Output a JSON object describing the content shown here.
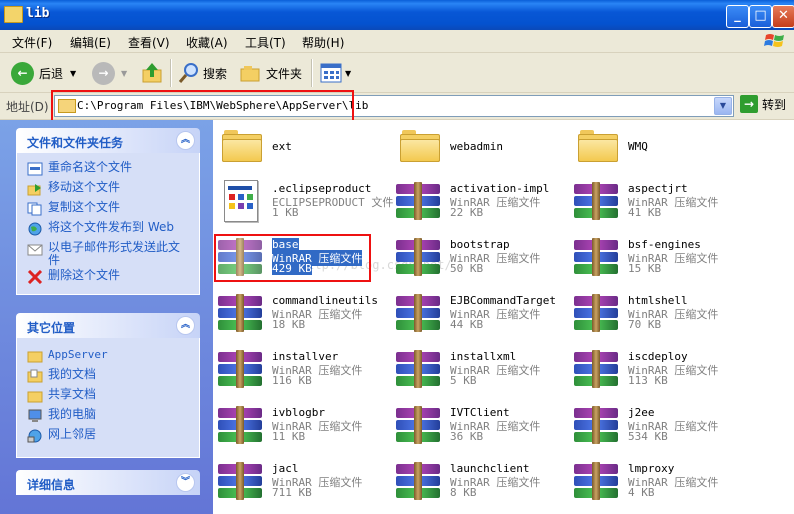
{
  "window": {
    "title": "lib"
  },
  "menu": [
    "文件(F)",
    "编辑(E)",
    "查看(V)",
    "收藏(A)",
    "工具(T)",
    "帮助(H)"
  ],
  "toolbar": {
    "back": "后退",
    "search": "搜索",
    "folders": "文件夹"
  },
  "address": {
    "label": "地址(D)",
    "path": "C:\\Program Files\\IBM\\WebSphere\\AppServer\\lib",
    "go": "转到"
  },
  "tasks": {
    "title": "文件和文件夹任务",
    "items": [
      "重命名这个文件",
      "移动这个文件",
      "复制这个文件",
      "将这个文件发布到 Web",
      "以电子邮件形式发送此文件",
      "删除这个文件"
    ]
  },
  "places": {
    "title": "其它位置",
    "items": [
      "AppServer",
      "我的文档",
      "共享文档",
      "我的电脑",
      "网上邻居"
    ]
  },
  "details": {
    "title": "详细信息"
  },
  "files": [
    {
      "name": "ext",
      "kind": "folder"
    },
    {
      "name": "webadmin",
      "kind": "folder"
    },
    {
      "name": "WMQ",
      "kind": "folder"
    },
    {
      "name": ".eclipseproduct",
      "type": "ECLIPSEPRODUCT 文件",
      "size": "1 KB",
      "kind": "doc"
    },
    {
      "name": "activation-impl",
      "type": "WinRAR 压缩文件",
      "size": "22 KB",
      "kind": "rar"
    },
    {
      "name": "aspectjrt",
      "type": "WinRAR 压缩文件",
      "size": "41 KB",
      "kind": "rar"
    },
    {
      "name": "base",
      "type": "WinRAR 压缩文件",
      "size": "429 KB",
      "kind": "rar",
      "selected": true
    },
    {
      "name": "bootstrap",
      "type": "WinRAR 压缩文件",
      "size": "50 KB",
      "kind": "rar"
    },
    {
      "name": "bsf-engines",
      "type": "WinRAR 压缩文件",
      "size": "15 KB",
      "kind": "rar"
    },
    {
      "name": "commandlineutils",
      "type": "WinRAR 压缩文件",
      "size": "18 KB",
      "kind": "rar"
    },
    {
      "name": "EJBCommandTarget",
      "type": "WinRAR 压缩文件",
      "size": "44 KB",
      "kind": "rar"
    },
    {
      "name": "htmlshell",
      "type": "WinRAR 压缩文件",
      "size": "70 KB",
      "kind": "rar"
    },
    {
      "name": "installver",
      "type": "WinRAR 压缩文件",
      "size": "116 KB",
      "kind": "rar"
    },
    {
      "name": "installxml",
      "type": "WinRAR 压缩文件",
      "size": "5 KB",
      "kind": "rar"
    },
    {
      "name": "iscdeploy",
      "type": "WinRAR 压缩文件",
      "size": "113 KB",
      "kind": "rar"
    },
    {
      "name": "ivblogbr",
      "type": "WinRAR 压缩文件",
      "size": "11 KB",
      "kind": "rar"
    },
    {
      "name": "IVTClient",
      "type": "WinRAR 压缩文件",
      "size": "36 KB",
      "kind": "rar"
    },
    {
      "name": "j2ee",
      "type": "WinRAR 压缩文件",
      "size": "534 KB",
      "kind": "rar"
    },
    {
      "name": "jacl",
      "type": "WinRAR 压缩文件",
      "size": "711 KB",
      "kind": "rar"
    },
    {
      "name": "launchclient",
      "type": "WinRAR 压缩文件",
      "size": "8 KB",
      "kind": "rar"
    },
    {
      "name": "lmproxy",
      "type": "WinRAR 压缩文件",
      "size": "4 KB",
      "kind": "rar"
    }
  ],
  "watermark": "http://blog.csdn.net/",
  "colors": {
    "accent": "#215dc6",
    "selection": "#316ac5",
    "annotation": "#ee1111"
  }
}
